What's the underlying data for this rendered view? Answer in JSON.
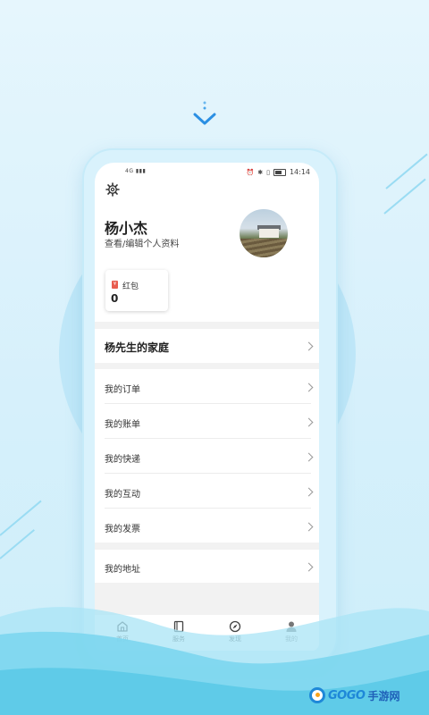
{
  "status_bar": {
    "network": "4G",
    "time": "14:14"
  },
  "profile": {
    "name": "杨小杰",
    "edit_link": "查看/编辑个人资料"
  },
  "wallet": {
    "icon": "red-packet-icon",
    "label": "红包",
    "value": "0"
  },
  "family": {
    "label": "杨先生的家庭"
  },
  "menu": {
    "items": [
      {
        "label": "我的订单"
      },
      {
        "label": "我的账单"
      },
      {
        "label": "我的快递"
      },
      {
        "label": "我的互动"
      },
      {
        "label": "我的发票"
      }
    ]
  },
  "address": {
    "label": "我的地址"
  },
  "tabs": [
    {
      "label": "首页",
      "icon": "home-icon"
    },
    {
      "label": "服务",
      "icon": "service-icon"
    },
    {
      "label": "发现",
      "icon": "compass-icon"
    },
    {
      "label": "我的",
      "icon": "person-icon",
      "active": true
    }
  ],
  "watermark": {
    "brand": "GOGO",
    "suffix": "手游网"
  },
  "colors": {
    "background": "#e6f6fd",
    "accent": "#2b9fe0",
    "wave": "#6fd3ec"
  }
}
